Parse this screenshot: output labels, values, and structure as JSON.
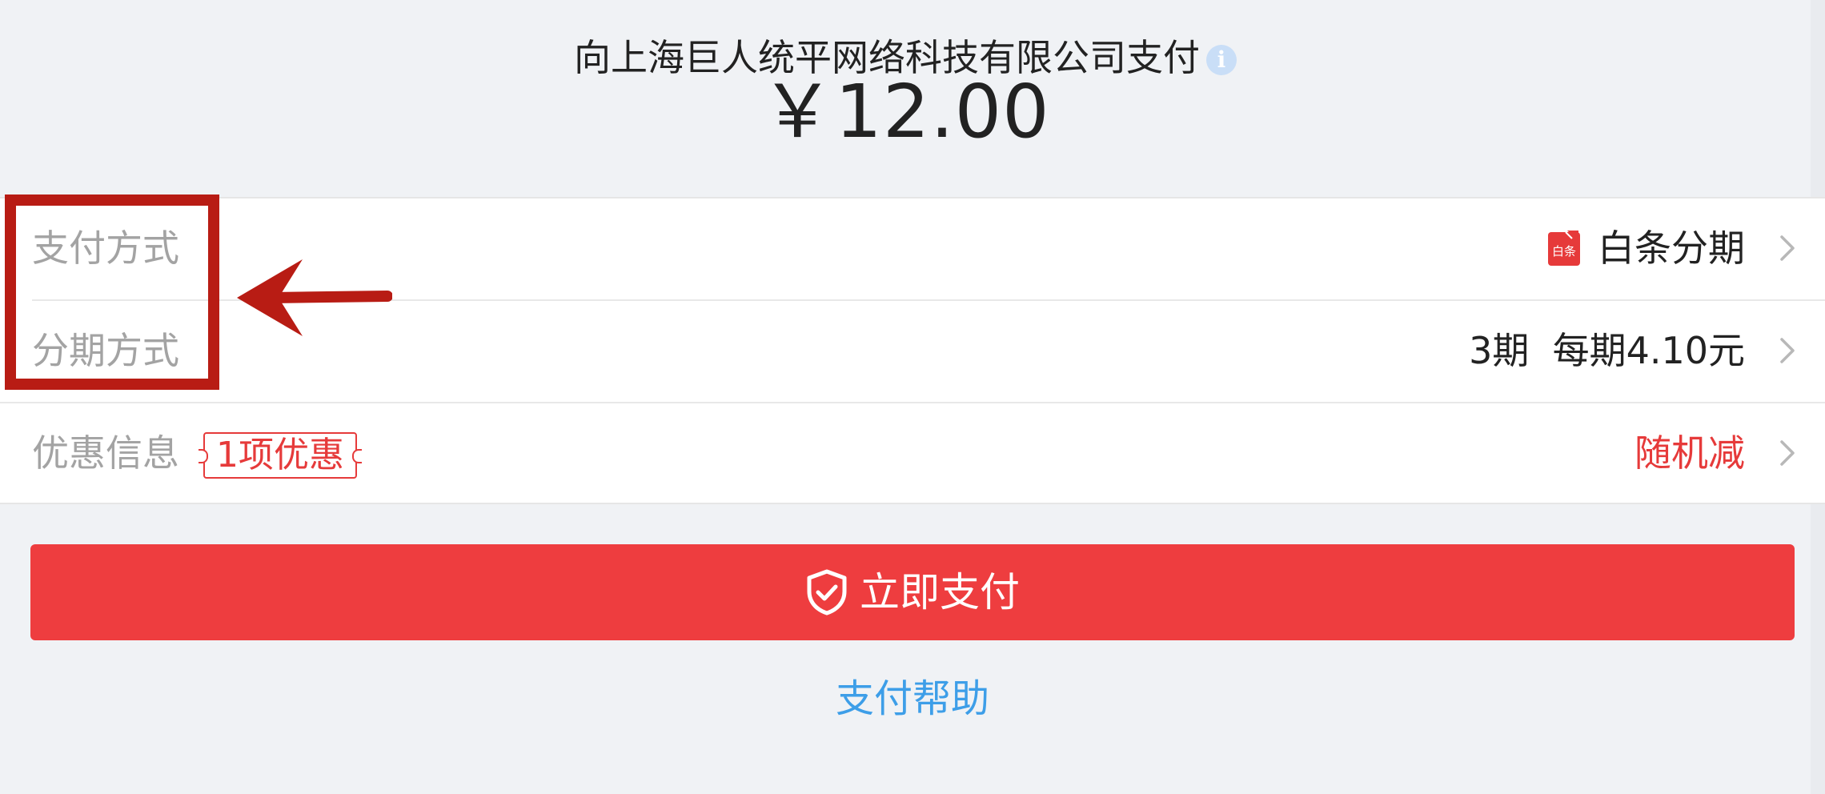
{
  "header": {
    "merchant_text": "向上海巨人统平网络科技有限公司支付",
    "info_icon": "info-icon",
    "amount": "￥12.00"
  },
  "rows": {
    "payment_method": {
      "label": "支付方式",
      "value": "白条分期",
      "logo_text": "白条",
      "logo_icon": "baitiao-logo",
      "chevron_icon": "chevron-right-icon"
    },
    "installment": {
      "label": "分期方式",
      "value": "3期  每期4.10元",
      "chevron_icon": "chevron-right-icon"
    },
    "promotion": {
      "label": "优惠信息",
      "badge": "1项优惠",
      "value": "随机减",
      "chevron_icon": "chevron-right-icon"
    }
  },
  "actions": {
    "pay_label": "立即支付",
    "pay_icon": "shield-check-icon",
    "help_label": "支付帮助"
  },
  "annotation": {
    "box_color": "#b81c14",
    "arrow_icon": "arrow-left-icon"
  },
  "colors": {
    "accent_red": "#ee3d3f",
    "link_blue": "#3d9ee8",
    "label_gray": "#a3a3a3",
    "background": "#f0f2f5"
  }
}
